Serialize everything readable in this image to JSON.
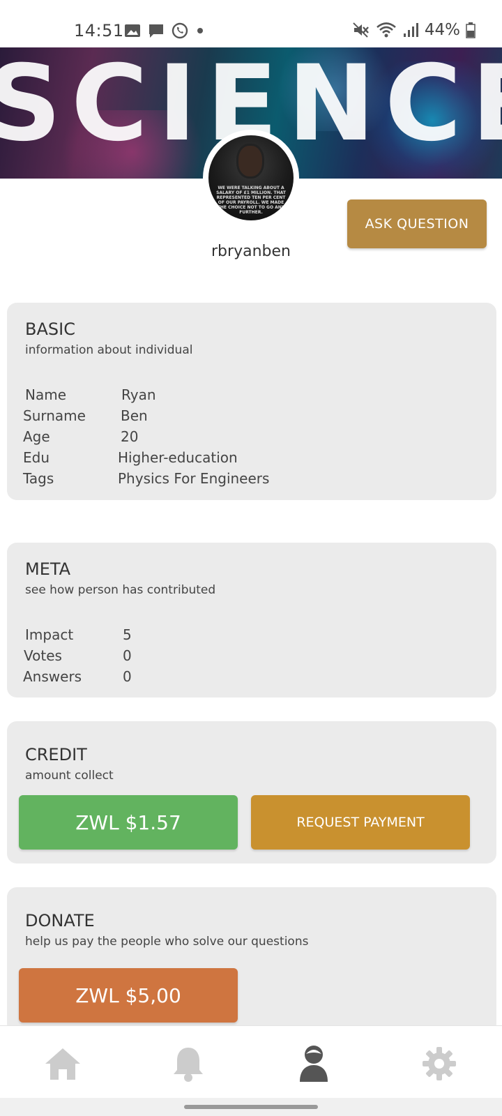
{
  "status_bar": {
    "time": "14:51",
    "battery_percent": "44%"
  },
  "banner": {
    "text": "SCIENCE"
  },
  "profile": {
    "username": "rbryanben",
    "avatar_caption": "WE WERE TALKING ABOUT A SALARY OF £1 MILLION. THAT REPRESENTED TEN PER CENT OF OUR PAYROLL. WE MADE THE CHOICE NOT TO GO ANY FURTHER."
  },
  "actions": {
    "ask_question": "ASK QUESTION"
  },
  "basic": {
    "title": "BASIC",
    "subtitle": "information about individual",
    "rows": [
      {
        "label": "Name",
        "value": "Ryan"
      },
      {
        "label": "Surname",
        "value": "Ben"
      },
      {
        "label": "Age",
        "value": "20"
      },
      {
        "label": "Edu",
        "value": "Higher-education"
      },
      {
        "label": "Tags",
        "value": "Physics For Engineers"
      }
    ]
  },
  "meta": {
    "title": "META",
    "subtitle": "see how person has contributed",
    "rows": [
      {
        "label": "Impact",
        "value": "5"
      },
      {
        "label": "Votes",
        "value": "0"
      },
      {
        "label": "Answers",
        "value": "0"
      }
    ]
  },
  "credit": {
    "title": "CREDIT",
    "subtitle": "amount collect",
    "amount": "ZWL $1.57",
    "request_label": "REQUEST PAYMENT"
  },
  "donate": {
    "title": "DONATE",
    "subtitle": "help us pay the people who solve our questions",
    "amount": "ZWL $5,00"
  },
  "bottom_nav": {
    "items": [
      {
        "icon": "home-icon",
        "active": false
      },
      {
        "icon": "bell-icon",
        "active": false
      },
      {
        "icon": "profile-icon",
        "active": true
      },
      {
        "icon": "gear-icon",
        "active": false
      }
    ],
    "active_color": "#555555",
    "inactive_color": "#cccccc"
  },
  "colors": {
    "accent_gold": "#b68a43",
    "credit_green": "#62b35f",
    "request_orange": "#c9912f",
    "donate_rust": "#cf7540",
    "card_bg": "#ebebeb"
  }
}
